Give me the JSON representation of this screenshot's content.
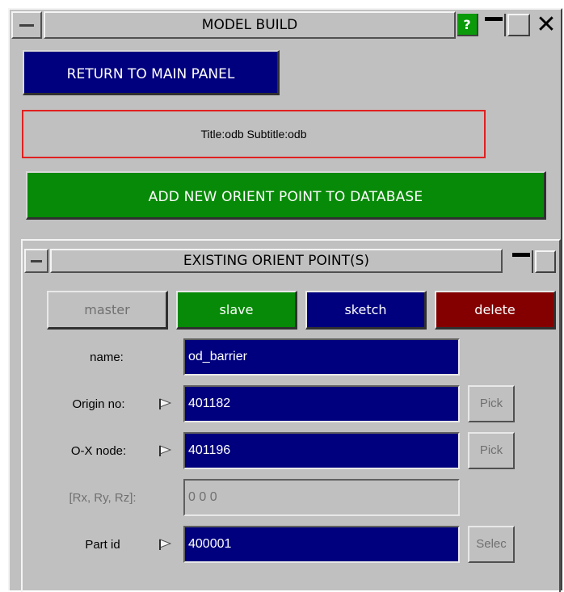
{
  "window": {
    "title": "MODEL BUILD",
    "help_label": "?",
    "close_label": "✕"
  },
  "main": {
    "return_label": "RETURN TO MAIN PANEL",
    "title_info": "Title:odb  Subtitle:odb",
    "add_label": "ADD NEW ORIENT POINT TO DATABASE"
  },
  "panel": {
    "title": "EXISTING ORIENT POINT(S)",
    "modes": {
      "master": "master",
      "slave": "slave",
      "sketch": "sketch",
      "delete": "delete"
    },
    "fields": {
      "name_label": "name:",
      "name_value": "od_barrier",
      "origin_label": "Origin no:",
      "origin_value": "401182",
      "origin_pick": "Pick",
      "ox_label": "O-X node:",
      "ox_value": "401196",
      "ox_pick": "Pick",
      "rxyz_label": "[Rx, Ry, Rz]:",
      "rxyz_value": "0 0 0",
      "part_label": "Part id",
      "part_value": "400001",
      "part_select": "Selec"
    }
  },
  "colors": {
    "navy": "#00007e",
    "green": "#078a07",
    "dark_red": "#840000",
    "panel_grey": "#c0c0c0"
  }
}
